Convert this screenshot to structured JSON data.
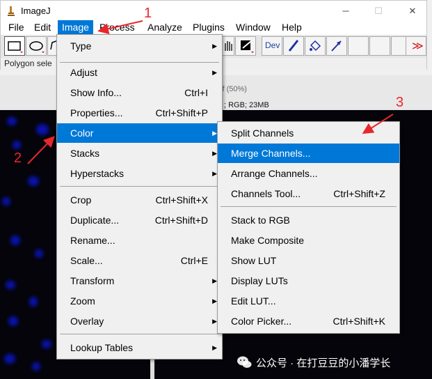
{
  "window": {
    "title": "ImageJ",
    "controls": {
      "minimize": "─",
      "maximize": "☐",
      "close": "✕"
    }
  },
  "menubar": [
    "File",
    "Edit",
    "Image",
    "Process",
    "Analyze",
    "Plugins",
    "Window",
    "Help"
  ],
  "toolbar": {
    "dev_label": "Dev",
    "more": "≫"
  },
  "status": "Polygon sele",
  "image_window": {
    "info_line1": "tif (50%)",
    "info_line2": "; RGB; 23MB"
  },
  "image_menu": {
    "items": [
      {
        "label": "Type",
        "shortcut": "",
        "submenu": true
      },
      {
        "label": "Adjust",
        "shortcut": "",
        "submenu": true
      },
      {
        "label": "Show Info...",
        "shortcut": "Ctrl+I",
        "submenu": false
      },
      {
        "label": "Properties...",
        "shortcut": "Ctrl+Shift+P",
        "submenu": false
      },
      {
        "label": "Color",
        "shortcut": "",
        "submenu": true
      },
      {
        "label": "Stacks",
        "shortcut": "",
        "submenu": true
      },
      {
        "label": "Hyperstacks",
        "shortcut": "",
        "submenu": true
      },
      {
        "label": "Crop",
        "shortcut": "Ctrl+Shift+X",
        "submenu": false
      },
      {
        "label": "Duplicate...",
        "shortcut": "Ctrl+Shift+D",
        "submenu": false
      },
      {
        "label": "Rename...",
        "shortcut": "",
        "submenu": false
      },
      {
        "label": "Scale...",
        "shortcut": "Ctrl+E",
        "submenu": false
      },
      {
        "label": "Transform",
        "shortcut": "",
        "submenu": true
      },
      {
        "label": "Zoom",
        "shortcut": "",
        "submenu": true
      },
      {
        "label": "Overlay",
        "shortcut": "",
        "submenu": true
      },
      {
        "label": "Lookup Tables",
        "shortcut": "",
        "submenu": true
      }
    ]
  },
  "color_menu": {
    "items": [
      {
        "label": "Split Channels",
        "shortcut": ""
      },
      {
        "label": "Merge Channels...",
        "shortcut": ""
      },
      {
        "label": "Arrange Channels...",
        "shortcut": ""
      },
      {
        "label": "Channels Tool...",
        "shortcut": "Ctrl+Shift+Z"
      },
      {
        "label": "Stack to RGB",
        "shortcut": ""
      },
      {
        "label": "Make Composite",
        "shortcut": ""
      },
      {
        "label": "Show LUT",
        "shortcut": ""
      },
      {
        "label": "Display LUTs",
        "shortcut": ""
      },
      {
        "label": "Edit LUT...",
        "shortcut": ""
      },
      {
        "label": "Color Picker...",
        "shortcut": "Ctrl+Shift+K"
      }
    ]
  },
  "annotations": [
    "1",
    "2",
    "3"
  ],
  "watermark": "公众号 · 在打豆豆的小潘学长",
  "colors": {
    "highlight": "#0078d7",
    "annotation": "#e8272c"
  }
}
